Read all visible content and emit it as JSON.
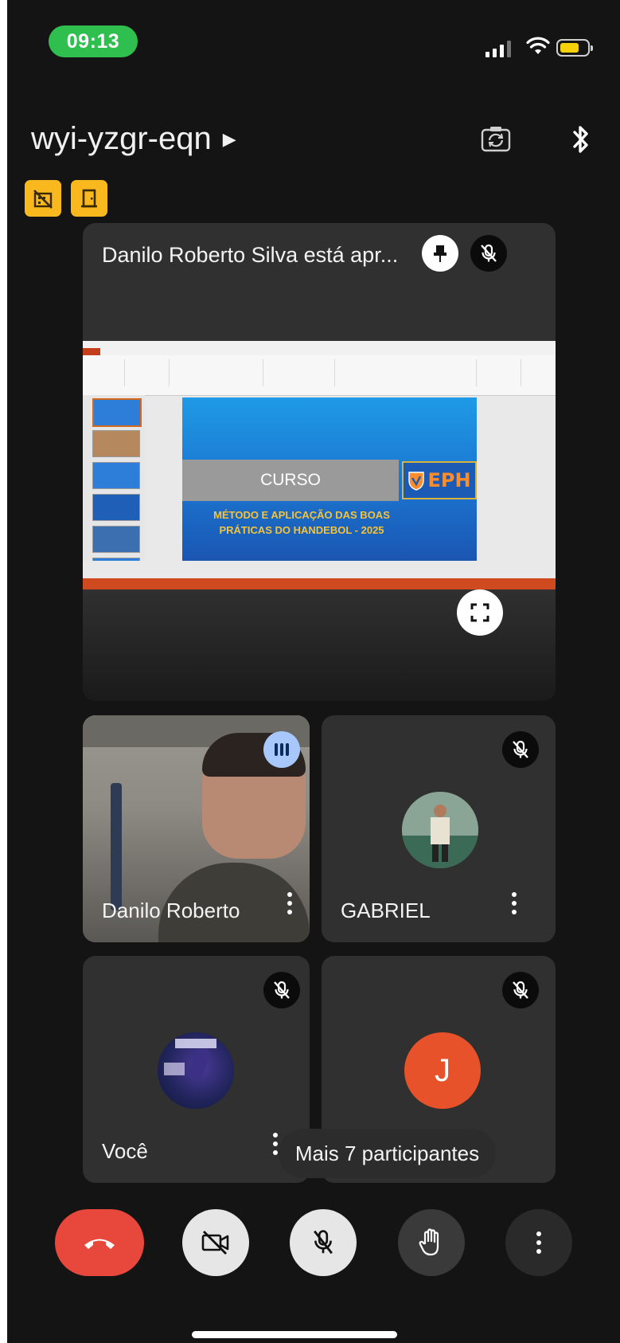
{
  "status_bar": {
    "time": "09:13"
  },
  "header": {
    "meeting_code": "wyi-yzgr-eqn"
  },
  "presentation": {
    "title": "Danilo Roberto Silva está apr...",
    "slide": {
      "course_label": "CURSO",
      "logo_text": "EPH",
      "subtitle_line1": "MÉTODO E APLICAÇÃO DAS BOAS",
      "subtitle_line2": "PRÁTICAS DO HANDEBOL - 2025"
    }
  },
  "participants": [
    {
      "name": "Danilo Roberto"
    },
    {
      "name": "GABRIEL"
    },
    {
      "name": "Você"
    },
    {
      "name": "",
      "initial": "J"
    }
  ],
  "more_participants": "Mais 7 participantes",
  "colors": {
    "background": "#141414",
    "tile": "#303030",
    "status_green": "#2fbf4f",
    "badge_yellow": "#f9b81d",
    "end_call_red": "#e8473c",
    "avatar_orange": "#e8522a",
    "speaking_blue": "#a8c7fa"
  },
  "icons": [
    "pin-icon",
    "mic-off-icon",
    "fullscreen-icon",
    "camera-flip-icon",
    "bluetooth-icon",
    "speaking-indicator-icon",
    "end-call-icon",
    "camera-off-icon",
    "raise-hand-icon",
    "more-vert-icon"
  ]
}
